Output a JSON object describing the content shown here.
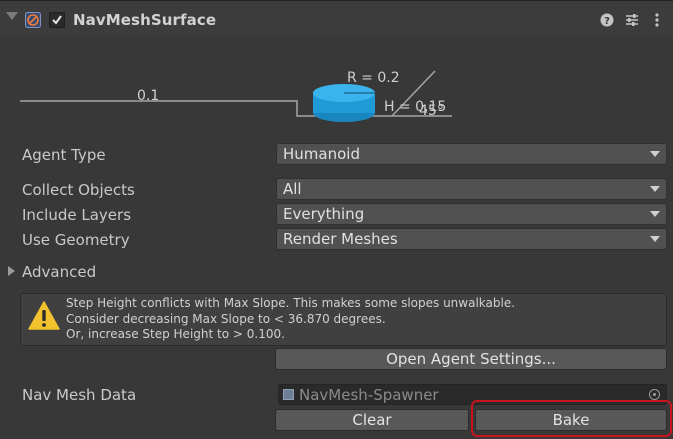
{
  "header": {
    "title": "NavMeshSurface",
    "enabled": true,
    "icons": [
      "navmesh-surface-icon",
      "help-icon",
      "presets-icon",
      "more-icon"
    ]
  },
  "diagram": {
    "step_label": "0.1",
    "radius_label": "R = 0.2",
    "height_label": "H = 0.15",
    "slope_label": "45°",
    "agent_color": "#1f9ad6"
  },
  "fields": {
    "agent_type": {
      "label": "Agent Type",
      "value": "Humanoid"
    },
    "collect_objects": {
      "label": "Collect Objects",
      "value": "All"
    },
    "include_layers": {
      "label": "Include Layers",
      "value": "Everything"
    },
    "use_geometry": {
      "label": "Use Geometry",
      "value": "Render Meshes"
    }
  },
  "advanced": {
    "label": "Advanced"
  },
  "warning": {
    "lines": [
      "Step Height conflicts with Max Slope. This makes some slopes unwalkable.",
      "Consider decreasing Max Slope to < 36.870 degrees.",
      "Or, increase Step Height to > 0.100."
    ],
    "icon_color": "#f2c12e"
  },
  "buttons": {
    "open_agent_settings": "Open Agent Settings...",
    "clear": "Clear",
    "bake": "Bake"
  },
  "nav_mesh_data": {
    "label": "Nav Mesh Data",
    "value": "NavMesh-Spawner"
  },
  "highlight_color": "#c8141c"
}
